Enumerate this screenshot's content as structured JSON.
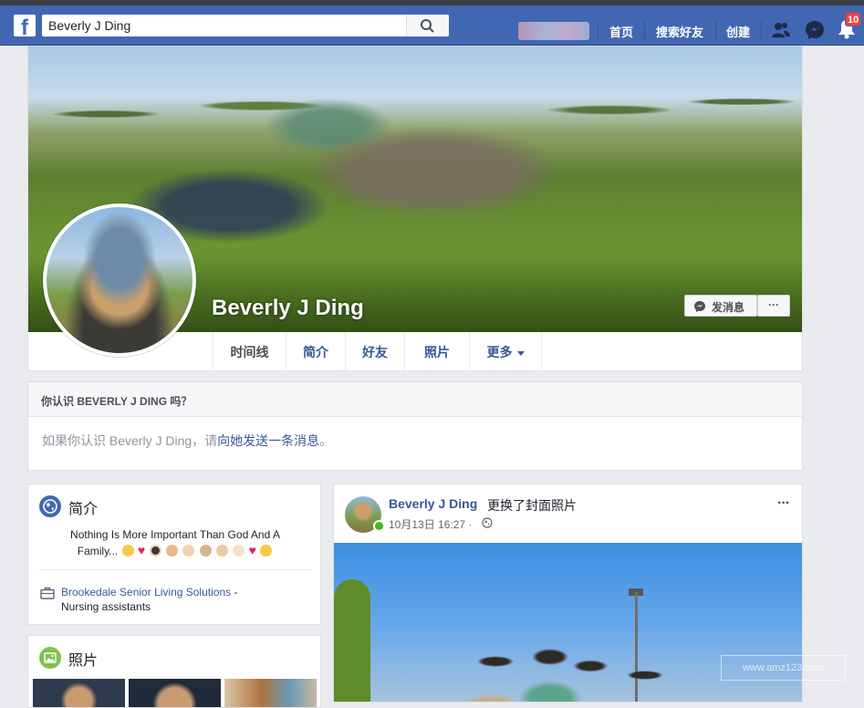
{
  "header": {
    "search_value": "Beverly J Ding",
    "nav": [
      "首页",
      "搜索好友",
      "创建"
    ],
    "notifications_badge": "10",
    "icons": [
      "facebook-logo-icon",
      "search-icon",
      "friend-requests-icon",
      "messenger-icon",
      "notifications-bell-icon"
    ]
  },
  "profile": {
    "name": "Beverly J Ding",
    "message_button": "发消息",
    "more_button": "···",
    "tabs": [
      {
        "label": "时间线"
      },
      {
        "label": "简介"
      },
      {
        "label": "好友"
      },
      {
        "label": "照片"
      },
      {
        "label": "更多"
      }
    ]
  },
  "know_card": {
    "heading": "你认识 BEVERLY J DING 吗？",
    "text_prefix": "如果你认识 Beverly J Ding，请",
    "link_text": "向她发送一条消息",
    "text_suffix": "。"
  },
  "intro": {
    "title": "简介",
    "bio_line1": "Nothing Is More Important Than God And A",
    "bio_line2": "Family...",
    "work_link": "Brookedale Senior Living Solutions",
    "work_sep": " -",
    "work_role": "Nursing assistants"
  },
  "photos": {
    "title": "照片"
  },
  "post": {
    "author": "Beverly J Ding",
    "action": "更换了封面照片",
    "time": "10月13日 16:27 ·",
    "more": "···"
  },
  "watermark": "www.amz123.com",
  "colors": {
    "brand_blue": "#4267b2",
    "link_blue": "#365899",
    "page_bg": "#e9ebee",
    "badge_red": "#fa3e3e",
    "online_green": "#42b72a"
  }
}
